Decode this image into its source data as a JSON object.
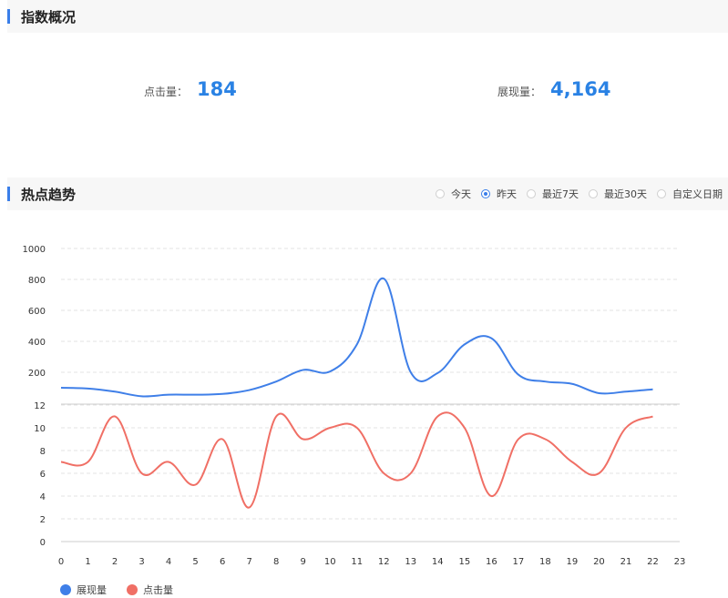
{
  "overview": {
    "title": "指数概况",
    "clicks": {
      "label": "点击量：",
      "value": "184"
    },
    "impressions": {
      "label": "展现量：",
      "value": "4,164"
    }
  },
  "trend": {
    "title": "热点趋势",
    "range_options": [
      {
        "label": "今天",
        "selected": false
      },
      {
        "label": "昨天",
        "selected": true
      },
      {
        "label": "最近7天",
        "selected": false
      },
      {
        "label": "最近30天",
        "selected": false
      },
      {
        "label": "自定义日期",
        "selected": false
      }
    ]
  },
  "colors": {
    "accent": "#3a7ee9",
    "impressions": "#3f7fe8",
    "clicks": "#f06f65"
  },
  "chart_data": [
    {
      "type": "line",
      "x": [
        0,
        1,
        2,
        3,
        4,
        5,
        6,
        7,
        8,
        9,
        10,
        11,
        12,
        13,
        14,
        15,
        16,
        17,
        18,
        19,
        20,
        21,
        22
      ],
      "xlim": [
        0,
        23
      ],
      "xticks": [
        "0",
        "1",
        "2",
        "3",
        "4",
        "5",
        "6",
        "7",
        "8",
        "9",
        "10",
        "11",
        "12",
        "13",
        "14",
        "15",
        "16",
        "17",
        "18",
        "19",
        "20",
        "21",
        "22",
        "23"
      ],
      "yticks": [
        "1000",
        "800",
        "600",
        "400",
        "200"
      ],
      "ylim": [
        0,
        1000
      ],
      "series": [
        {
          "name": "展现量",
          "color": "#3f7fe8",
          "values": [
            100,
            95,
            75,
            45,
            55,
            55,
            60,
            85,
            140,
            215,
            205,
            380,
            805,
            200,
            195,
            380,
            420,
            185,
            140,
            125,
            65,
            75,
            90
          ]
        }
      ]
    },
    {
      "type": "line",
      "x": [
        0,
        1,
        2,
        3,
        4,
        5,
        6,
        7,
        8,
        9,
        10,
        11,
        12,
        13,
        14,
        15,
        16,
        17,
        18,
        19,
        20,
        21,
        22
      ],
      "xlim": [
        0,
        23
      ],
      "yticks": [
        "12",
        "10",
        "8",
        "6",
        "4",
        "2",
        "0"
      ],
      "ylim": [
        0,
        12
      ],
      "series": [
        {
          "name": "点击量",
          "color": "#f06f65",
          "values": [
            7,
            7,
            11,
            6,
            7,
            5,
            9,
            3,
            11,
            9,
            10,
            10,
            6,
            6,
            11,
            10,
            4,
            9,
            9,
            7,
            6,
            10,
            11
          ]
        }
      ]
    }
  ],
  "legend": [
    {
      "label": "展现量",
      "color": "#3f7fe8"
    },
    {
      "label": "点击量",
      "color": "#f06f65"
    }
  ]
}
